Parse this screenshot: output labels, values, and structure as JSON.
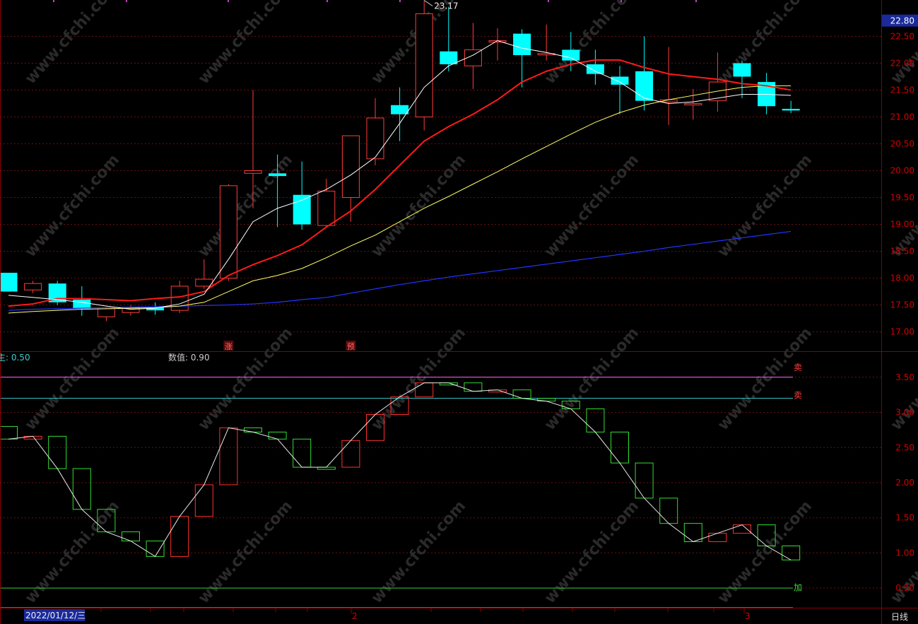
{
  "colors": {
    "background": "#000000",
    "up": "#ff3b3b",
    "down": "#00ffff",
    "frame": "#8b0000",
    "axis_text": "#d40000",
    "ma5": "#ffffff",
    "ma10": "#ff1a1a",
    "ma20": "#ffff66",
    "ma60": "#2233ff",
    "osc_up": "#ff3030",
    "osc_down": "#33dd33",
    "line_upper": "#ff66ff",
    "line_mid": "#33cccc",
    "line_lower_1": "#33cc33",
    "line_lower_2": "#cccc33",
    "price_label_bg": "#1a2a9a",
    "watermark": "#2a2a2a"
  },
  "watermark_text": "www.cfchi.com",
  "price_panel": {
    "current_price_label": "22.80",
    "y_ticks": [
      "22.50",
      "22.00",
      "21.50",
      "21.00",
      "20.50",
      "20.00",
      "19.50",
      "19.00",
      "18.50",
      "18.00",
      "17.50",
      "17.00"
    ],
    "high_annotation": "23.17",
    "markers": [
      {
        "text": "涨",
        "index": 9
      },
      {
        "text": "预",
        "index": 14
      }
    ],
    "chart_data": {
      "type": "candlestick",
      "ylim": [
        16.85,
        23.15
      ],
      "x": [
        1,
        2,
        3,
        4,
        5,
        6,
        7,
        8,
        9,
        10,
        11,
        12,
        13,
        14,
        15,
        16,
        17,
        18,
        19,
        20,
        21,
        22,
        23,
        24,
        25,
        26,
        27,
        28,
        29,
        30,
        31,
        32,
        33
      ],
      "ohlc": [
        [
          18.1,
          18.1,
          17.75,
          17.75
        ],
        [
          17.78,
          17.95,
          17.72,
          17.9
        ],
        [
          17.9,
          17.95,
          17.5,
          17.55
        ],
        [
          17.6,
          17.85,
          17.3,
          17.43
        ],
        [
          17.28,
          17.45,
          17.2,
          17.43
        ],
        [
          17.36,
          17.5,
          17.3,
          17.45
        ],
        [
          17.45,
          17.55,
          17.32,
          17.4
        ],
        [
          17.4,
          17.95,
          17.35,
          17.85
        ],
        [
          17.85,
          18.35,
          17.8,
          17.98
        ],
        [
          18.0,
          19.75,
          17.95,
          19.72
        ],
        [
          19.95,
          21.5,
          19.3,
          20.0
        ],
        [
          19.95,
          20.3,
          18.95,
          19.9
        ],
        [
          19.55,
          20.17,
          18.9,
          19.0
        ],
        [
          18.98,
          19.85,
          18.95,
          19.62
        ],
        [
          19.5,
          20.45,
          19.05,
          20.65
        ],
        [
          20.22,
          21.35,
          20.1,
          20.98
        ],
        [
          21.22,
          21.55,
          20.55,
          21.05
        ],
        [
          21.0,
          23.17,
          20.75,
          22.92
        ],
        [
          22.22,
          23.05,
          21.85,
          21.98
        ],
        [
          21.95,
          22.75,
          21.52,
          22.25
        ],
        [
          22.42,
          22.65,
          22.05,
          22.42
        ],
        [
          22.55,
          22.63,
          21.55,
          22.15
        ],
        [
          22.18,
          22.72,
          22.05,
          22.18
        ],
        [
          22.25,
          22.58,
          21.85,
          22.05
        ],
        [
          21.98,
          22.25,
          21.6,
          21.8
        ],
        [
          21.75,
          21.95,
          21.05,
          21.6
        ],
        [
          21.85,
          22.5,
          21.12,
          21.3
        ],
        [
          21.28,
          22.3,
          20.85,
          21.32
        ],
        [
          21.25,
          21.52,
          20.95,
          21.25
        ],
        [
          21.3,
          22.2,
          21.1,
          21.65
        ],
        [
          22.0,
          22.05,
          21.35,
          21.75
        ],
        [
          21.65,
          21.82,
          21.05,
          21.2
        ],
        [
          21.15,
          21.3,
          21.07,
          21.12
        ]
      ],
      "ma5": [
        17.68,
        17.64,
        17.6,
        17.55,
        17.48,
        17.42,
        17.44,
        17.52,
        17.7,
        18.35,
        19.05,
        19.3,
        19.45,
        19.65,
        19.92,
        20.25,
        20.88,
        21.55,
        21.95,
        22.15,
        22.42,
        22.28,
        22.2,
        22.1,
        21.85,
        21.65,
        21.35,
        21.25,
        21.28,
        21.35,
        21.42,
        21.42,
        21.4
      ],
      "ma10": [
        17.48,
        17.52,
        17.62,
        17.62,
        17.6,
        17.58,
        17.62,
        17.65,
        17.75,
        18.05,
        18.25,
        18.42,
        18.62,
        18.95,
        19.25,
        19.65,
        20.1,
        20.55,
        20.82,
        21.05,
        21.32,
        21.65,
        21.85,
        21.98,
        22.06,
        22.06,
        21.92,
        21.8,
        21.75,
        21.7,
        21.62,
        21.58,
        21.5
      ],
      "ma20": [
        17.35,
        17.38,
        17.4,
        17.42,
        17.43,
        17.44,
        17.45,
        17.48,
        17.55,
        17.75,
        17.95,
        18.05,
        18.18,
        18.38,
        18.6,
        18.8,
        19.05,
        19.3,
        19.52,
        19.75,
        19.98,
        20.22,
        20.45,
        20.68,
        20.9,
        21.08,
        21.22,
        21.32,
        21.4,
        21.48,
        21.55,
        21.58,
        21.58
      ],
      "ma60": [
        17.4,
        17.42,
        17.43,
        17.44,
        17.45,
        17.46,
        17.47,
        17.48,
        17.49,
        17.5,
        17.52,
        17.55,
        17.6,
        17.64,
        17.72,
        17.8,
        17.88,
        17.95,
        18.02,
        18.08,
        18.14,
        18.2,
        18.26,
        18.32,
        18.38,
        18.44,
        18.5,
        18.57,
        18.63,
        18.69,
        18.75,
        18.81,
        18.87
      ]
    }
  },
  "indicator_panel": {
    "label_left": "主: 0.50",
    "label_value": "数值: 0.90",
    "y_ticks": [
      "3.50",
      "3.00",
      "2.50",
      "2.00",
      "1.50",
      "1.00",
      "0.50"
    ],
    "side_labels": [
      {
        "text": "卖",
        "value": 3.2
      },
      {
        "text": "加",
        "value": 0.75
      }
    ],
    "chart_data": {
      "type": "boxes",
      "ylim": [
        0.22,
        3.85
      ],
      "levels": [
        3.5,
        3.2,
        0.5,
        0.22
      ],
      "boxes": [
        [
          2.8,
          2.62
        ],
        [
          2.62,
          2.66
        ],
        [
          2.66,
          2.2
        ],
        [
          2.2,
          1.62
        ],
        [
          1.62,
          1.3
        ],
        [
          1.3,
          1.17
        ],
        [
          1.17,
          0.95
        ],
        [
          0.95,
          1.52
        ],
        [
          1.52,
          1.97
        ],
        [
          1.97,
          2.78
        ],
        [
          2.78,
          2.72
        ],
        [
          2.72,
          2.62
        ],
        [
          2.62,
          2.22
        ],
        [
          2.22,
          2.22
        ],
        [
          2.22,
          2.6
        ],
        [
          2.6,
          2.97
        ],
        [
          2.97,
          3.22
        ],
        [
          3.22,
          3.42
        ],
        [
          3.42,
          3.42
        ],
        [
          3.42,
          3.3
        ],
        [
          3.3,
          3.32
        ],
        [
          3.32,
          3.2
        ],
        [
          3.2,
          3.16
        ],
        [
          3.16,
          3.05
        ],
        [
          3.05,
          2.72
        ],
        [
          2.72,
          2.28
        ],
        [
          2.28,
          1.78
        ],
        [
          1.78,
          1.42
        ],
        [
          1.42,
          1.16
        ],
        [
          1.16,
          1.28
        ],
        [
          1.28,
          1.4
        ],
        [
          1.4,
          1.1
        ],
        [
          1.1,
          0.9
        ]
      ]
    }
  },
  "bottom_bar": {
    "date": "2022/01/12/三",
    "month_labels": [
      {
        "text": "2",
        "index": 14
      },
      {
        "text": "3",
        "index": 30
      }
    ],
    "period_label": "日线"
  }
}
